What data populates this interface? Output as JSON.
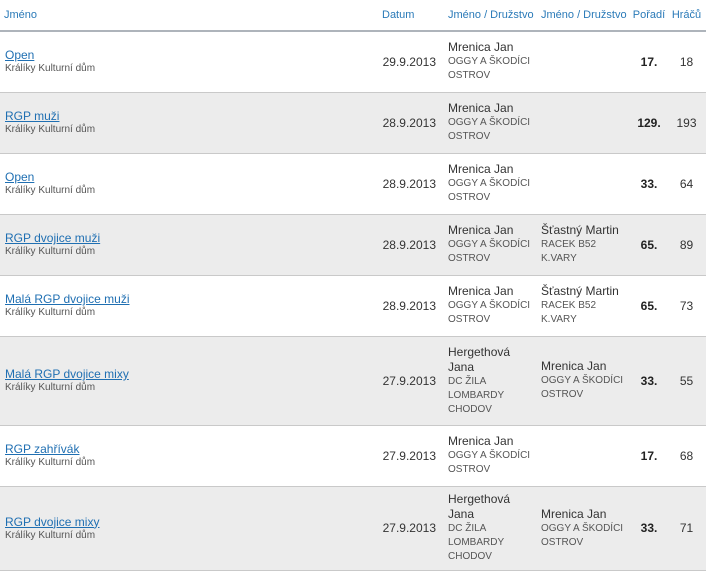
{
  "headers": {
    "name": "Jméno",
    "date": "Datum",
    "player1": "Jméno / Družstvo",
    "player2": "Jméno / Družstvo",
    "position": "Pořadí",
    "players": "Hráčů"
  },
  "rows": [
    {
      "event": "Open",
      "venue": "Králíky Kulturní dům",
      "date": "29.9.2013",
      "p1_name": "Mrenica Jan",
      "p1_team": "OGGY A ŠKODÍCI OSTROV",
      "p2_name": "",
      "p2_team": "",
      "position": "17.",
      "players": "18"
    },
    {
      "event": "RGP muži",
      "venue": "Králíky Kulturní dům",
      "date": "28.9.2013",
      "p1_name": "Mrenica Jan",
      "p1_team": "OGGY A ŠKODÍCI OSTROV",
      "p2_name": "",
      "p2_team": "",
      "position": "129.",
      "players": "193"
    },
    {
      "event": "Open",
      "venue": "Králíky Kulturní dům",
      "date": "28.9.2013",
      "p1_name": "Mrenica Jan",
      "p1_team": "OGGY A ŠKODÍCI OSTROV",
      "p2_name": "",
      "p2_team": "",
      "position": "33.",
      "players": "64"
    },
    {
      "event": "RGP dvojice muži",
      "venue": "Králíky Kulturní dům",
      "date": "28.9.2013",
      "p1_name": "Mrenica Jan",
      "p1_team": "OGGY A ŠKODÍCI OSTROV",
      "p2_name": "Šťastný Martin",
      "p2_team": "RACEK B52 K.VARY",
      "position": "65.",
      "players": "89"
    },
    {
      "event": "Malá RGP dvojice muži",
      "venue": "Králíky Kulturní dům",
      "date": "28.9.2013",
      "p1_name": "Mrenica Jan",
      "p1_team": "OGGY A ŠKODÍCI OSTROV",
      "p2_name": "Šťastný Martin",
      "p2_team": "RACEK B52 K.VARY",
      "position": "65.",
      "players": "73"
    },
    {
      "event": "Malá RGP dvojice mixy",
      "venue": "Králíky Kulturní dům",
      "date": "27.9.2013",
      "p1_name": "Hergethová Jana",
      "p1_team": "DC ŽILA LOMBARDY CHODOV",
      "p2_name": "Mrenica Jan",
      "p2_team": "OGGY A ŠKODÍCI OSTROV",
      "position": "33.",
      "players": "55"
    },
    {
      "event": "RGP zahřívák",
      "venue": "Králíky Kulturní dům",
      "date": "27.9.2013",
      "p1_name": "Mrenica Jan",
      "p1_team": "OGGY A ŠKODÍCI OSTROV",
      "p2_name": "",
      "p2_team": "",
      "position": "17.",
      "players": "68"
    },
    {
      "event": "RGP dvojice mixy",
      "venue": "Králíky Kulturní dům",
      "date": "27.9.2013",
      "p1_name": "Hergethová Jana",
      "p1_team": "DC ŽILA LOMBARDY CHODOV",
      "p2_name": "Mrenica Jan",
      "p2_team": "OGGY A ŠKODÍCI OSTROV",
      "position": "33.",
      "players": "71"
    }
  ]
}
